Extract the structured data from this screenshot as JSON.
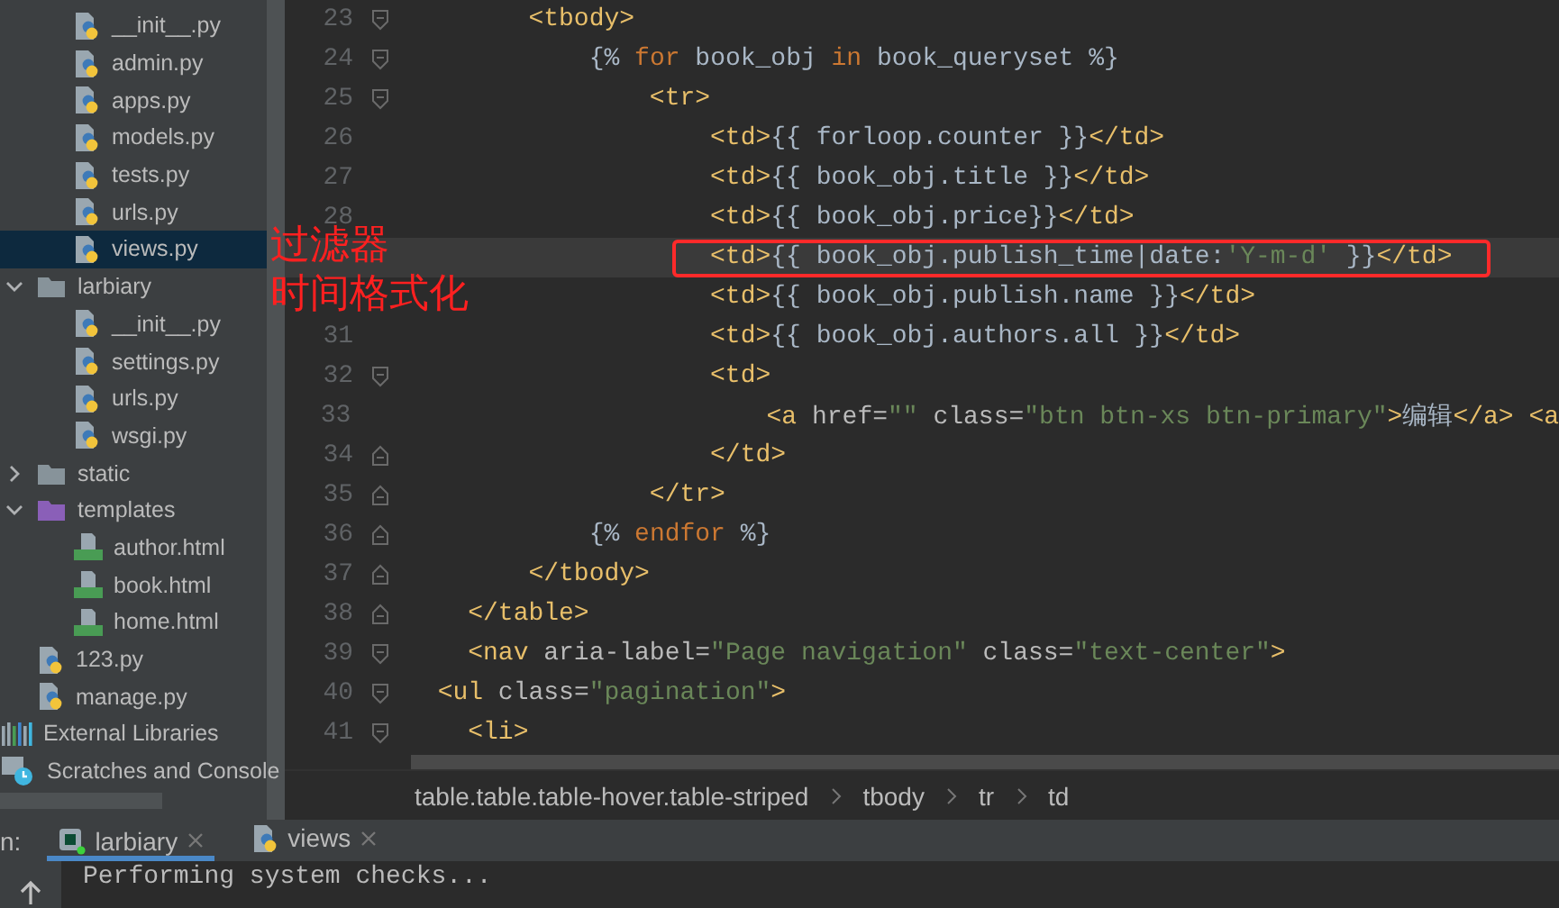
{
  "project_tree": {
    "items": [
      {
        "kind": "cut-off",
        "children": [
          {
            "kind": "cut-off",
            "children": [
              {
                "kind": "python",
                "label": "__init__.py",
                "selected": false
              },
              {
                "kind": "python",
                "label": "admin.py",
                "selected": false
              },
              {
                "kind": "python",
                "label": "apps.py",
                "selected": false
              },
              {
                "kind": "python",
                "label": "models.py",
                "selected": false
              },
              {
                "kind": "python",
                "label": "tests.py",
                "selected": false
              },
              {
                "kind": "python",
                "label": "urls.py",
                "selected": false
              },
              {
                "kind": "python",
                "label": "views.py",
                "selected": true
              }
            ]
          },
          {
            "kind": "folder",
            "label": "larbiary",
            "selected": false,
            "expanded": true,
            "children": [
              {
                "kind": "python",
                "label": "__init__.py",
                "selected": false
              },
              {
                "kind": "python",
                "label": "settings.py",
                "selected": false
              },
              {
                "kind": "python",
                "label": "urls.py",
                "selected": false
              },
              {
                "kind": "python",
                "label": "wsgi.py",
                "selected": false
              }
            ]
          },
          {
            "kind": "folder",
            "label": "static",
            "selected": false,
            "expanded": false
          },
          {
            "kind": "templates-folder",
            "label": "templates",
            "selected": false,
            "expanded": true,
            "children": [
              {
                "kind": "html",
                "label": "author.html",
                "selected": false
              },
              {
                "kind": "html",
                "label": "book.html",
                "selected": false
              },
              {
                "kind": "html",
                "label": "home.html",
                "selected": false
              }
            ]
          },
          {
            "kind": "python",
            "label": "123.py",
            "selected": false
          },
          {
            "kind": "python",
            "label": "manage.py",
            "selected": false
          }
        ]
      },
      {
        "kind": "libraries",
        "label": "External Libraries",
        "selected": false
      },
      {
        "kind": "scratches",
        "label": "Scratches and Console",
        "selected": false
      }
    ]
  },
  "editor": {
    "lines": [
      {
        "number": "23",
        "fold_start": true,
        "fold_end": false,
        "tokens": [
          {
            "kind": "tag",
            "text": "        <tbody>"
          }
        ]
      },
      {
        "number": "24",
        "fold_start": true,
        "fold_end": false,
        "tokens": [
          {
            "kind": "text",
            "text": "            {% "
          },
          {
            "kind": "kw",
            "text": "for"
          },
          {
            "kind": "text",
            "text": " book_obj "
          },
          {
            "kind": "kw",
            "text": "in"
          },
          {
            "kind": "text",
            "text": " book_queryset %}"
          }
        ]
      },
      {
        "number": "25",
        "fold_start": true,
        "fold_end": false,
        "tokens": [
          {
            "kind": "tag",
            "text": "                <tr>"
          }
        ]
      },
      {
        "number": "26",
        "fold_start": false,
        "fold_end": false,
        "tokens": [
          {
            "kind": "tag",
            "text": "                    <td>"
          },
          {
            "kind": "text",
            "text": "{{ forloop.counter }}"
          },
          {
            "kind": "tag",
            "text": "</td>"
          }
        ]
      },
      {
        "number": "27",
        "fold_start": false,
        "fold_end": false,
        "tokens": [
          {
            "kind": "tag",
            "text": "                    <td>"
          },
          {
            "kind": "text",
            "text": "{{ book_obj.title }}"
          },
          {
            "kind": "tag",
            "text": "</td>"
          }
        ]
      },
      {
        "number": "28",
        "fold_start": false,
        "fold_end": false,
        "tokens": [
          {
            "kind": "tag",
            "text": "                    <td>"
          },
          {
            "kind": "text",
            "text": "{{ book_obj.price}}"
          },
          {
            "kind": "tag",
            "text": "</td>"
          }
        ]
      },
      {
        "fold_start": false,
        "fold_end": false,
        "current": true,
        "boxed": true,
        "tokens": [
          {
            "kind": "tag",
            "text": "                    <td>"
          },
          {
            "kind": "text",
            "text": "{{ book_obj.publish_time|date:"
          },
          {
            "kind": "str",
            "text": "'Y-m-d'"
          },
          {
            "kind": "text",
            "text": " }}"
          },
          {
            "kind": "tag",
            "text": "</td>"
          }
        ]
      },
      {
        "fold_start": false,
        "fold_end": false,
        "tokens": [
          {
            "kind": "tag",
            "text": "                    <td>"
          },
          {
            "kind": "text",
            "text": "{{ book_obj.publish.name }}"
          },
          {
            "kind": "tag",
            "text": "</td>"
          }
        ]
      },
      {
        "number": "31",
        "fold_start": false,
        "fold_end": false,
        "tokens": [
          {
            "kind": "tag",
            "text": "                    <td>"
          },
          {
            "kind": "text",
            "text": "{{ book_obj.authors.all }}"
          },
          {
            "kind": "tag",
            "text": "</td>"
          }
        ]
      },
      {
        "number": "32",
        "fold_start": true,
        "fold_end": false,
        "tokens": [
          {
            "kind": "tag",
            "text": "                    <td>"
          }
        ]
      },
      {
        "number": "33",
        "fold_start": false,
        "fold_end": false,
        "tokens": [
          {
            "kind": "tag",
            "text": "                        <a"
          },
          {
            "kind": "attr",
            "text": " href="
          },
          {
            "kind": "str",
            "text": "\"\""
          },
          {
            "kind": "attr",
            "text": " class="
          },
          {
            "kind": "str",
            "text": "\"btn btn-xs btn-primary\""
          },
          {
            "kind": "tag",
            "text": ">"
          },
          {
            "kind": "text",
            "text": "编辑"
          },
          {
            "kind": "tag",
            "text": "</a> <a"
          }
        ]
      },
      {
        "number": "34",
        "fold_start": false,
        "fold_end": true,
        "tokens": [
          {
            "kind": "tag",
            "text": "                    </td>"
          }
        ]
      },
      {
        "number": "35",
        "fold_start": false,
        "fold_end": true,
        "tokens": [
          {
            "kind": "tag",
            "text": "                </tr>"
          }
        ]
      },
      {
        "number": "36",
        "fold_start": false,
        "fold_end": true,
        "tokens": [
          {
            "kind": "text",
            "text": "            {% "
          },
          {
            "kind": "kw",
            "text": "endfor"
          },
          {
            "kind": "text",
            "text": " %}"
          }
        ]
      },
      {
        "number": "37",
        "fold_start": false,
        "fold_end": true,
        "tokens": [
          {
            "kind": "tag",
            "text": "        </tbody>"
          }
        ]
      },
      {
        "number": "38",
        "fold_start": false,
        "fold_end": true,
        "tokens": [
          {
            "kind": "tag",
            "text": "    </table>"
          }
        ]
      },
      {
        "number": "39",
        "fold_start": true,
        "fold_end": false,
        "tokens": [
          {
            "kind": "tag",
            "text": "    <nav"
          },
          {
            "kind": "attr",
            "text": " aria-label="
          },
          {
            "kind": "str",
            "text": "\"Page navigation\""
          },
          {
            "kind": "attr",
            "text": " class="
          },
          {
            "kind": "str",
            "text": "\"text-center\""
          },
          {
            "kind": "tag",
            "text": ">"
          }
        ]
      },
      {
        "number": "40",
        "fold_start": true,
        "fold_end": false,
        "tokens": [
          {
            "kind": "tag",
            "text": "  <ul"
          },
          {
            "kind": "attr",
            "text": " class="
          },
          {
            "kind": "str",
            "text": "\"pagination\""
          },
          {
            "kind": "tag",
            "text": ">"
          }
        ]
      },
      {
        "number": "41",
        "fold_start": true,
        "fold_end": false,
        "tokens": [
          {
            "kind": "tag",
            "text": "    <li>"
          }
        ]
      }
    ]
  },
  "annotations": [
    "过滤器",
    "时间格式化"
  ],
  "breadcrumb": [
    "table.table.table-hover.table-striped",
    "tbody",
    "tr",
    "td"
  ],
  "run_panel": {
    "label": "n:",
    "tabs": [
      {
        "kind": "django",
        "label": "larbiary",
        "selected": true
      },
      {
        "kind": "python",
        "label": "views",
        "selected": false
      }
    ],
    "console": [
      "Performing system checks..."
    ]
  }
}
